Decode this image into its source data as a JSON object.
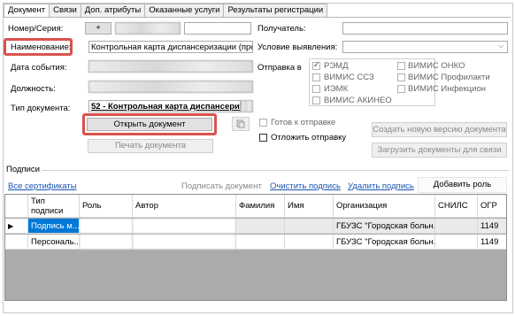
{
  "tabs": [
    {
      "label": "Документ",
      "active": true
    },
    {
      "label": "Связи",
      "active": false
    },
    {
      "label": "Доп. атрибуты",
      "active": false
    },
    {
      "label": "Оказанные услуги",
      "active": false
    },
    {
      "label": "Результаты регистрации",
      "active": false
    }
  ],
  "form": {
    "number_series_label": "Номер/Серия:",
    "plus_button": "+",
    "name_label": "Наименование:",
    "name_value": "Контрольная карта диспансеризации (профил",
    "event_date_label": "Дата события:",
    "position_label": "Должность:",
    "doc_type_label": "Тип документа:",
    "doc_type_value": "52 - Контрольная карта диспансеризац",
    "open_document_button": "Открыть документ",
    "print_document_button": "Печать документа",
    "recipient_label": "Получатель:",
    "detection_condition_label": "Условие выявления:",
    "send_to_label": "Отправка в",
    "ready_to_send_label": "Готов к отправке",
    "postpone_send_label": "Отложить отправку",
    "create_new_version_button": "Создать новую версию документа",
    "load_documents_button": "Загрузить документы для связи"
  },
  "send_targets": [
    {
      "label": "РЭМД",
      "checked": true
    },
    {
      "label": "ВИМИС ОНКО",
      "checked": false
    },
    {
      "label": "ВИМИС ССЗ",
      "checked": false
    },
    {
      "label": "ВИМИС Профилакти",
      "checked": false
    },
    {
      "label": "ИЭМК",
      "checked": false
    },
    {
      "label": "ВИМИС Инфекцион",
      "checked": false
    },
    {
      "label": "ВИМИС АКИНЕО",
      "checked": false
    }
  ],
  "signatures": {
    "section_label": "Подписи",
    "all_certificates_link": "Все сертификаты",
    "sign_document_link": "Подписать документ",
    "clear_signature_link": "Очистить подпись",
    "delete_signature_link": "Удалить подпись",
    "add_role_button": "Добавить роль",
    "columns": [
      "Тип подписи",
      "Роль",
      "Автор",
      "Фамилия",
      "Имя",
      "Организация",
      "СНИЛС",
      "ОГР"
    ],
    "rows": [
      {
        "type": "Подпись м...",
        "organization": "ГБУЗС \"Городская больн...",
        "ogrn": "1149"
      },
      {
        "type": "Персональ...",
        "organization": "ГБУЗС \"Городская больн...",
        "ogrn": "1149"
      }
    ]
  }
}
